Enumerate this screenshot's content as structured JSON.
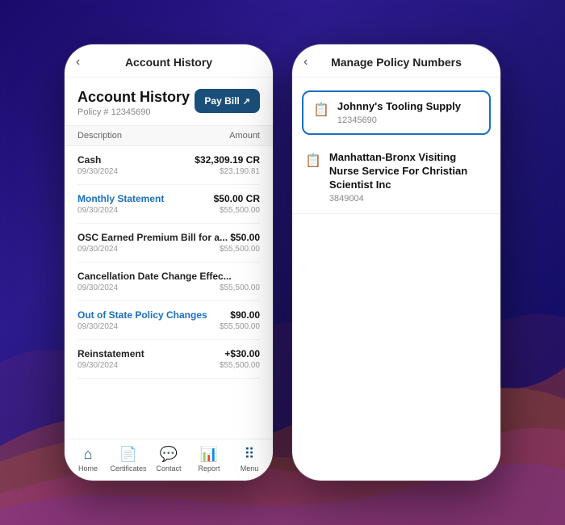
{
  "background": {
    "gradient_start": "#1a0a6b",
    "gradient_end": "#0d0a5e"
  },
  "left_phone": {
    "header": {
      "back_label": "‹",
      "title": "Account History"
    },
    "account_title": "Account History",
    "policy_label": "Policy # 12345690",
    "pay_bill_label": "Pay Bill",
    "table_columns": {
      "description": "Description",
      "amount": "Amount"
    },
    "transactions": [
      {
        "name": "Cash",
        "link": false,
        "amount": "$32,309.19 CR",
        "date": "09/30/2024",
        "sub_amount": "$23,190.81"
      },
      {
        "name": "Monthly Statement",
        "link": true,
        "amount": "$50.00 CR",
        "date": "09/30/2024",
        "sub_amount": "$55,500.00"
      },
      {
        "name": "OSC Earned Premium Bill for a...",
        "link": false,
        "amount": "$50.00",
        "date": "09/30/2024",
        "sub_amount": "$55,500.00"
      },
      {
        "name": "Cancellation Date Change Effec...",
        "link": false,
        "amount": "",
        "date": "09/30/2024",
        "sub_amount": "$55,500.00"
      },
      {
        "name": "Out of State Policy Changes",
        "link": true,
        "amount": "$90.00",
        "date": "09/30/2024",
        "sub_amount": "$55,500.00"
      },
      {
        "name": "Reinstatement",
        "link": false,
        "amount": "+$30.00",
        "date": "09/30/2024",
        "sub_amount": "$55,500.00"
      }
    ],
    "nav_items": [
      {
        "label": "Home",
        "icon": "⌂",
        "active": true
      },
      {
        "label": "Certificates",
        "icon": "📄",
        "active": false
      },
      {
        "label": "Contact",
        "icon": "💬",
        "active": false
      },
      {
        "label": "Report",
        "icon": "📊",
        "active": false
      },
      {
        "label": "Menu",
        "icon": "⠿",
        "active": false
      }
    ]
  },
  "right_phone": {
    "header": {
      "back_label": "‹",
      "title": "Manage Policy Numbers"
    },
    "policies": [
      {
        "name": "Johnny's Tooling Supply",
        "number": "12345690",
        "selected": true
      },
      {
        "name": "Manhattan-Bronx Visiting Nurse Service For Christian Scientist Inc",
        "number": "3849004",
        "selected": false
      }
    ]
  }
}
